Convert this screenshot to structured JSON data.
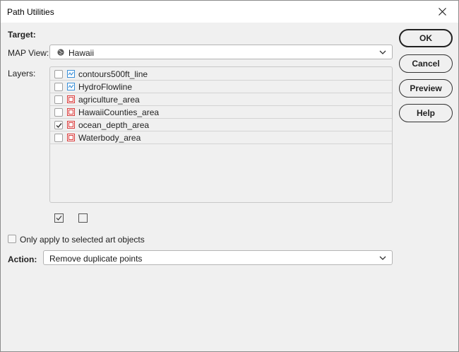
{
  "window": {
    "title": "Path Utilities"
  },
  "target": {
    "heading": "Target:",
    "map_view_label": "MAP View:",
    "map_view_value": "Hawaii",
    "layers_label": "Layers:"
  },
  "layers": [
    {
      "name": "contours500ft_line",
      "type": "line",
      "checked": false
    },
    {
      "name": "HydroFlowline",
      "type": "line",
      "checked": false
    },
    {
      "name": "agriculture_area",
      "type": "area",
      "checked": false
    },
    {
      "name": "HawaiiCounties_area",
      "type": "area",
      "checked": false
    },
    {
      "name": "ocean_depth_area",
      "type": "area",
      "checked": true
    },
    {
      "name": "Waterbody_area",
      "type": "area",
      "checked": false
    }
  ],
  "options": {
    "only_selected_label": "Only apply to selected art objects"
  },
  "action": {
    "label": "Action:",
    "value": "Remove duplicate points"
  },
  "buttons": {
    "ok": "OK",
    "cancel": "Cancel",
    "preview": "Preview",
    "help": "Help"
  },
  "colors": {
    "line_icon": "#3a8fd8",
    "area_icon": "#d93a3a"
  }
}
